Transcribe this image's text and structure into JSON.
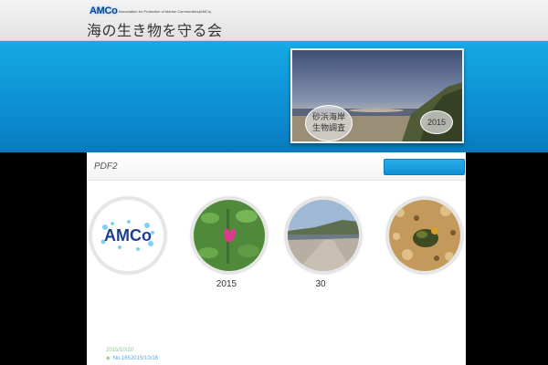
{
  "header": {
    "logo_text": "AMCo",
    "logo_subtitle": "Association for Protection of Marine Communities(AMCo)",
    "site_title": "海の生き物を守る会"
  },
  "banner": {
    "title_line1": "砂浜海岸",
    "title_line2": "生物調査",
    "year": "2015"
  },
  "section": {
    "title": "PDF2",
    "button_label": ""
  },
  "gallery": {
    "items": [
      {
        "icon": "amco-logo",
        "caption": "",
        "logo_text": "AMCo"
      },
      {
        "icon": "flower-photo",
        "caption": "2015"
      },
      {
        "icon": "beach-photo",
        "caption": "30"
      },
      {
        "icon": "crab-photo",
        "caption": ""
      }
    ]
  },
  "news": {
    "date": "2015/10/20",
    "link": "No.1652015/10/16"
  },
  "colors": {
    "band_blue": "#0b8ad0",
    "button_blue": "#1a9ede",
    "date_green": "#8fc68f",
    "link_blue": "#5aa3d8"
  }
}
